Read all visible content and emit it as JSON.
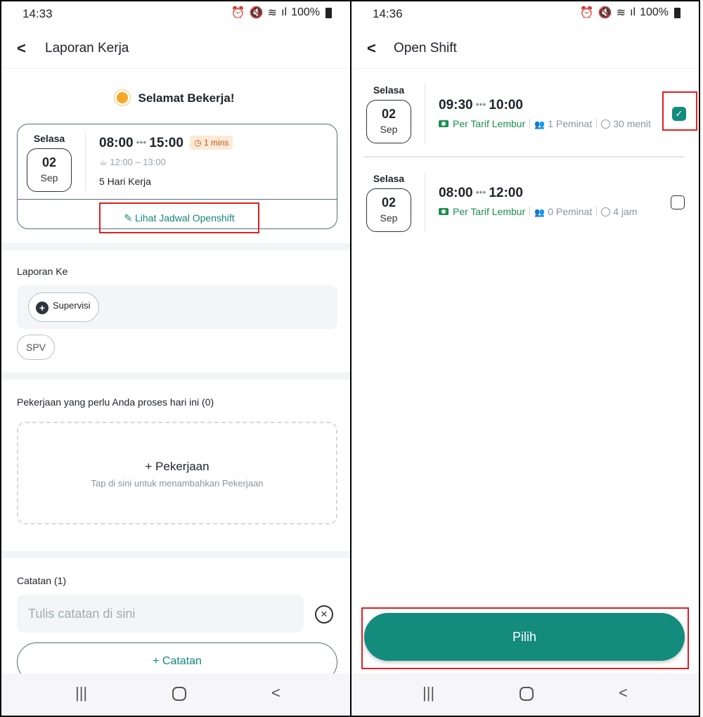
{
  "left": {
    "status": {
      "time": "14:33",
      "battery": "100%"
    },
    "appbar": {
      "back": "<",
      "title": "Laporan Kerja"
    },
    "greeting": "Selamat Bekerja!",
    "shift_card": {
      "day": "Selasa",
      "date": "02",
      "month": "Sep",
      "start": "08:00",
      "dots": "•••",
      "end": "15:00",
      "badge": "1 mins",
      "break_time": "12:00 – 13:00",
      "work_days": "5 Hari Kerja",
      "link": "Lihat Jadwal Openshift"
    },
    "report_to": {
      "label": "Laporan Ke",
      "chip": "Supervisi",
      "role_chip": "SPV"
    },
    "tasks": {
      "label": "Pekerjaan yang perlu Anda proses hari ini (0)",
      "add_title": "+ Pekerjaan",
      "add_hint": "Tap di sini untuk menambahkan Pekerjaan"
    },
    "notes": {
      "label": "Catatan (1)",
      "placeholder": "Tulis catatan di sini",
      "clear": "×",
      "add_button": "+  Catatan"
    }
  },
  "right": {
    "status": {
      "time": "14:36",
      "battery": "100%"
    },
    "appbar": {
      "back": "<",
      "title": "Open Shift"
    },
    "shifts": [
      {
        "day": "Selasa",
        "date": "02",
        "month": "Sep",
        "start": "09:30",
        "dots": "•••",
        "end": "10:00",
        "rate": "Per Tarif Lembur",
        "interested": "1 Peminat",
        "duration": "30 menit",
        "checked": true
      },
      {
        "day": "Selasa",
        "date": "02",
        "month": "Sep",
        "start": "08:00",
        "dots": "•••",
        "end": "12:00",
        "rate": "Per Tarif Lembur",
        "interested": "0 Peminat",
        "duration": "4 jam",
        "checked": false
      }
    ],
    "select_button": "Pilih"
  },
  "nav": {
    "recent": "|||",
    "back": "<"
  },
  "colors": {
    "accent": "#138b7d",
    "highlight": "#e02020",
    "rate_green": "#1a8f4f",
    "badge_bg": "#fde9d6"
  }
}
